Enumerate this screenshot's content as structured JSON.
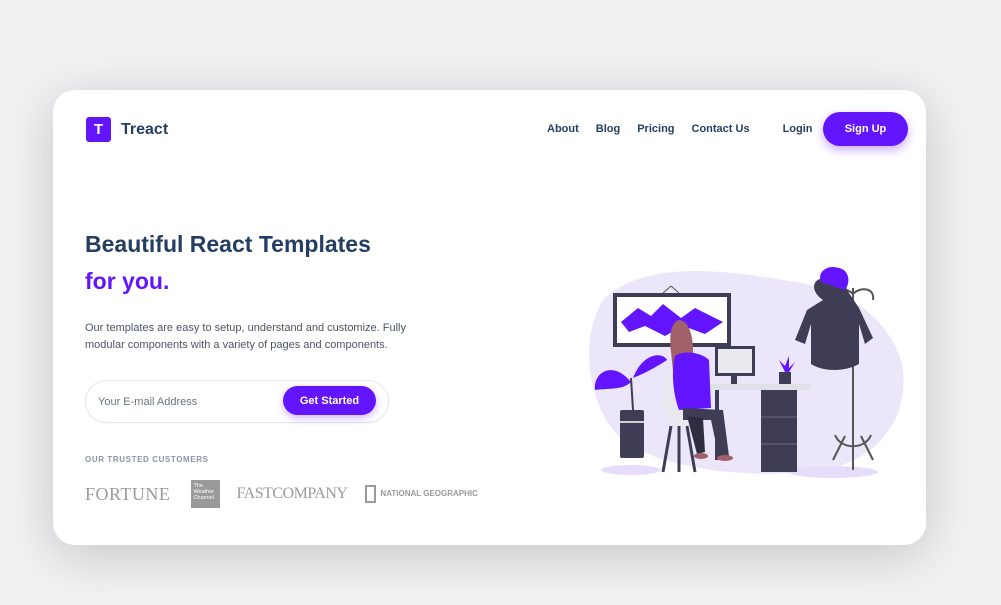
{
  "brand": {
    "name": "Treact",
    "mark": "T"
  },
  "nav": {
    "links": [
      "About",
      "Blog",
      "Pricing",
      "Contact Us"
    ],
    "login": "Login",
    "signup": "Sign Up"
  },
  "hero": {
    "heading_line1": "Beautiful React Templates",
    "heading_line2": "for you.",
    "description": "Our templates are easy to setup, understand and customize. Fully modular components with a variety of pages and components.",
    "email_placeholder": "Your E-mail Address",
    "cta": "Get Started"
  },
  "customers": {
    "label": "OUR TRUSTED CUSTOMERS",
    "logos": {
      "fortune": "FORTUNE",
      "weather_channel": "The Weather Channel",
      "fast_company": "FASTCOMPANY",
      "natgeo": "NATIONAL GEOGRAPHIC"
    }
  },
  "colors": {
    "primary": "#6415ff",
    "heading": "#243e63",
    "illustration_bg": "#ece6fb"
  },
  "illustration": {
    "icon": "woman-at-desk-illustration"
  }
}
